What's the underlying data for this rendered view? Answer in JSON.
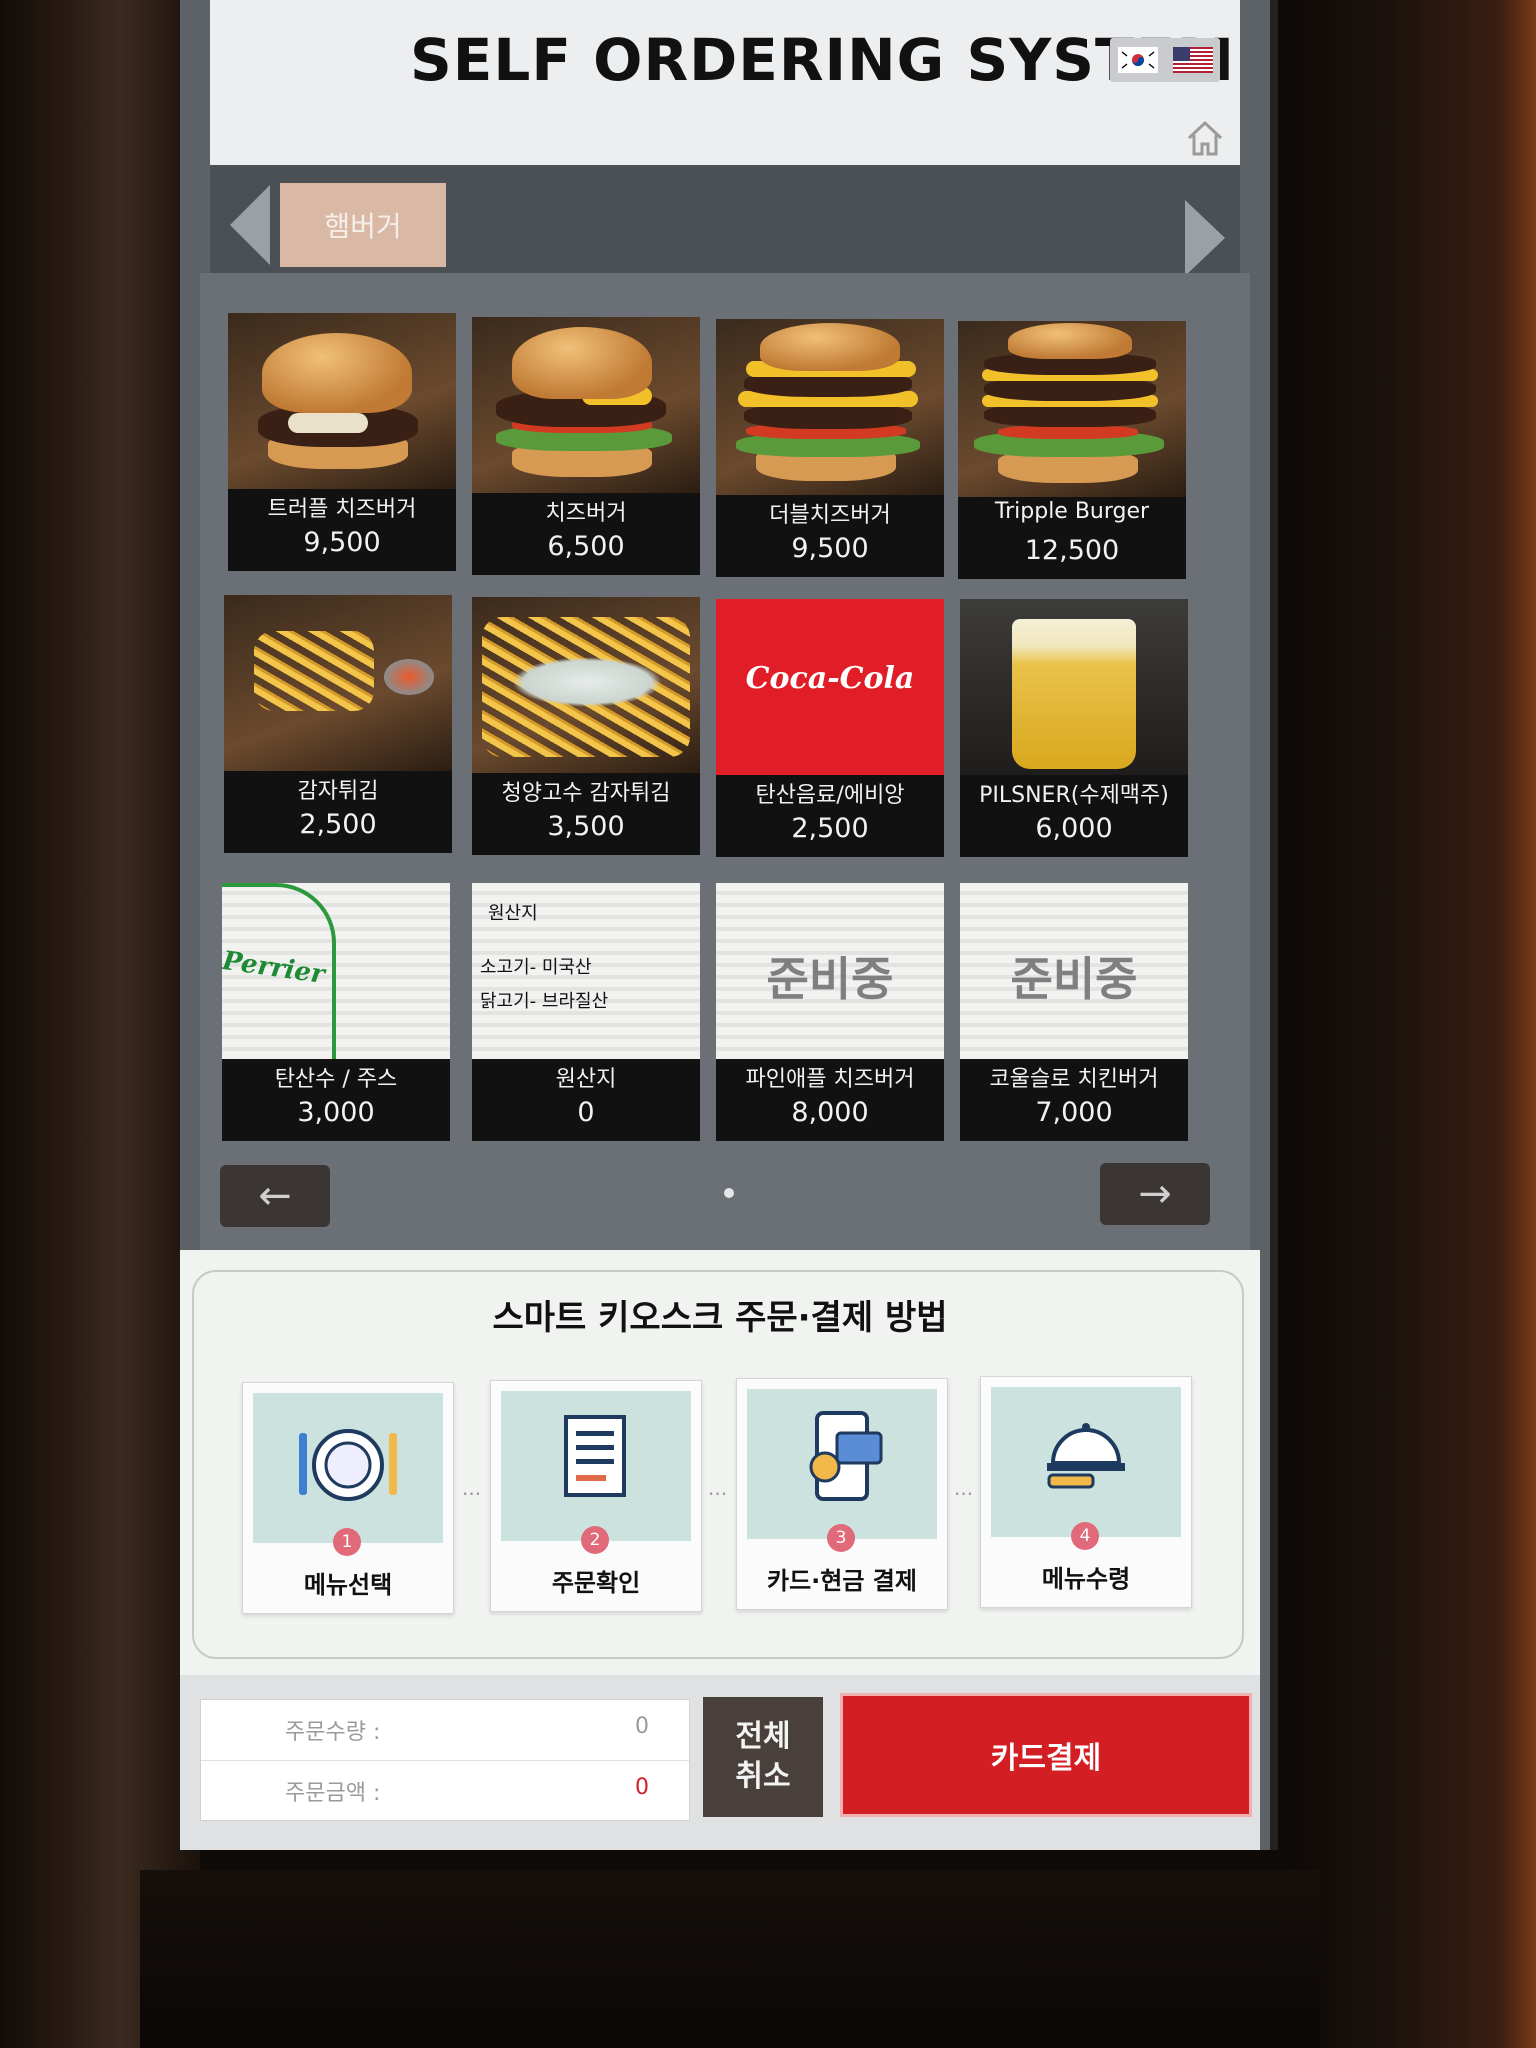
{
  "header": {
    "title": "SELF ORDERING SYSTEM",
    "languages": [
      "korean-flag-icon",
      "us-flag-icon"
    ],
    "home_icon": "home-icon"
  },
  "category_bar": {
    "active_tab": "햄버거"
  },
  "menu": {
    "items": [
      {
        "name": "트러플 치즈버거",
        "price": "9,500",
        "photo": "burger"
      },
      {
        "name": "치즈버거",
        "price": "6,500",
        "photo": "burger"
      },
      {
        "name": "더블치즈버거",
        "price": "9,500",
        "photo": "burger"
      },
      {
        "name": "Tripple Burger",
        "price": "12,500",
        "photo": "burger"
      },
      {
        "name": "감자튀김",
        "price": "2,500",
        "photo": "fries"
      },
      {
        "name": "청양고수 감자튀김",
        "price": "3,500",
        "photo": "fries"
      },
      {
        "name": "탄산음료/에비앙",
        "price": "2,500",
        "photo": "coke",
        "photo_text": "Coca-Cola"
      },
      {
        "name": "PILSNER(수제맥주)",
        "price": "6,000",
        "photo": "beer"
      },
      {
        "name": "탄산수 / 주스",
        "price": "3,000",
        "photo": "perrier",
        "photo_text": "Perrier"
      },
      {
        "name": "원산지",
        "price": "0",
        "photo": "origin",
        "photo_text": "원산지",
        "photo_lines": [
          "소고기- 미국산",
          "닭고기- 브라질산"
        ]
      },
      {
        "name": "파인애플 치즈버거",
        "price": "8,000",
        "photo": "preparing",
        "photo_text": "준비중"
      },
      {
        "name": "코울슬로 치킨버거",
        "price": "7,000",
        "photo": "preparing",
        "photo_text": "준비중"
      }
    ]
  },
  "pager": {
    "prev_icon": "arrow-left-icon",
    "next_icon": "arrow-right-icon"
  },
  "guide": {
    "title": "스마트 키오스크 주문·결제 방법",
    "steps": [
      {
        "num": "1",
        "label": "메뉴선택",
        "icon": "plate-cutlery-icon"
      },
      {
        "num": "2",
        "label": "주문확인",
        "icon": "receipt-icon"
      },
      {
        "num": "3",
        "label": "카드·현금 결제",
        "icon": "card-payment-icon"
      },
      {
        "num": "4",
        "label": "메뉴수령",
        "icon": "cloche-icon"
      }
    ]
  },
  "order": {
    "qty_label": "주문수량 :",
    "qty_value": "0",
    "amount_label": "주문금액 :",
    "amount_value": "0",
    "cancel_line1": "전체",
    "cancel_line2": "취소",
    "pay_label": "카드결제"
  },
  "colors": {
    "accent_red": "#d31e24",
    "tab_bg": "#d9b9a6",
    "step_badge": "#e06a7a"
  }
}
